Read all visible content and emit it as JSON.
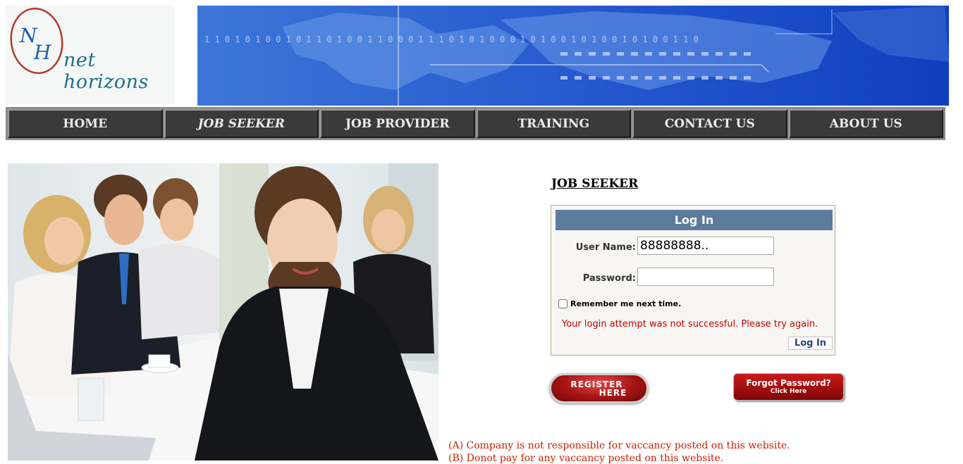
{
  "brand": {
    "logo_text": "net horizons",
    "logo_mark": "NH"
  },
  "nav": {
    "items": [
      {
        "label": "HOME"
      },
      {
        "label": "JOB SEEKER"
      },
      {
        "label": "JOB PROVIDER"
      },
      {
        "label": "TRAINING"
      },
      {
        "label": "CONTACT US"
      },
      {
        "label": "ABOUT US"
      }
    ],
    "active_index": 1
  },
  "section_title": "JOB SEEKER",
  "login": {
    "header": "Log In",
    "username_label": "User Name:",
    "username_value": "88888888..",
    "password_label": "Password:",
    "password_value": "",
    "remember_label": "Remember me next time.",
    "remember_checked": false,
    "error_text": "Your login attempt was not successful. Please try again.",
    "button_label": "Log In"
  },
  "register_button": {
    "line1": "REGISTER",
    "line2": "HERE"
  },
  "forgot_button": {
    "line1": "Forgot Password?",
    "line2": "Click Here"
  },
  "notices": [
    "(A) Company is not responsible for vaccancy posted on this website.",
    "(B) Donot pay for any vaccancy posted on this website."
  ],
  "colors": {
    "nav_bg": "#3a3a3a",
    "login_header": "#5d7b9d",
    "error": "#cc0000",
    "notice": "#cc2200",
    "banner": "#2a5fd0"
  }
}
